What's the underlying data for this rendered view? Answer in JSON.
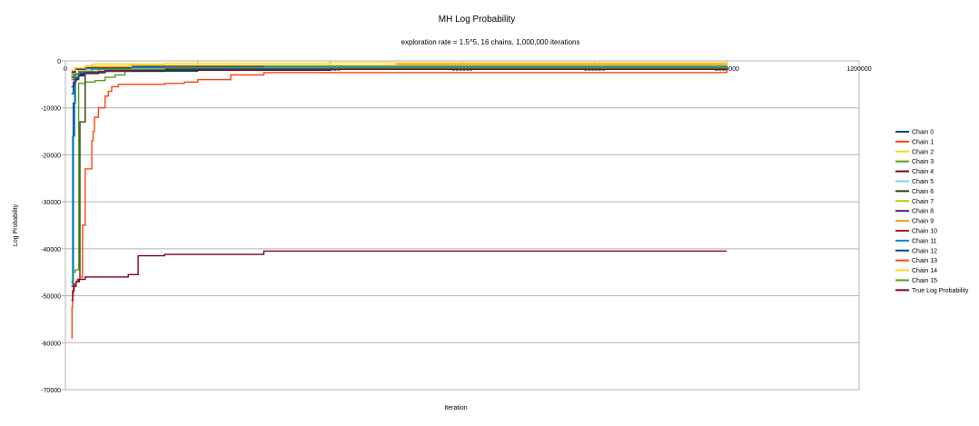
{
  "chart_data": {
    "type": "line",
    "title": "MH Log Probability",
    "subtitle": "exploration rate = 1.5^5, 16 chains, 1,000,000 iterations",
    "xlabel": "Iteration",
    "ylabel": "Log Probability",
    "xlim": [
      0,
      1200000
    ],
    "ylim": [
      -70000,
      0
    ],
    "x_ticks": [
      0,
      200000,
      400000,
      600000,
      800000,
      1000000,
      1200000
    ],
    "y_ticks": [
      0,
      -10000,
      -20000,
      -30000,
      -40000,
      -50000,
      -60000,
      -70000
    ],
    "grid": true,
    "legend_position": "right",
    "series": [
      {
        "name": "Chain 0",
        "color": "#004586",
        "step": true,
        "x": [
          9000,
          12000,
          15000,
          20000,
          60000,
          200000,
          400000,
          1000000
        ],
        "y": [
          -47000,
          -9000,
          -4000,
          -2500,
          -2200,
          -1800,
          -1300,
          -1000
        ]
      },
      {
        "name": "Chain 1",
        "color": "#ff420e",
        "step": true,
        "x": [
          9000,
          11000,
          15000,
          22000,
          50000,
          150000,
          300000,
          600000,
          1000000
        ],
        "y": [
          -3000,
          -2200,
          -1800,
          -1600,
          -1500,
          -1400,
          -1300,
          -1200,
          -1100
        ]
      },
      {
        "name": "Chain 2",
        "color": "#ffd320",
        "step": true,
        "x": [
          9000,
          15000,
          40000,
          150000,
          400000,
          1000000
        ],
        "y": [
          -3500,
          -1500,
          -700,
          -500,
          -400,
          -350
        ]
      },
      {
        "name": "Chain 3",
        "color": "#579d1c",
        "step": true,
        "x": [
          9000,
          12000,
          15000,
          20000,
          30000,
          45000,
          60000,
          75000,
          90000,
          110000,
          150000,
          200000,
          1000000
        ],
        "y": [
          -48000,
          -45000,
          -44500,
          -4800,
          -4500,
          -4200,
          -3500,
          -3000,
          -2200,
          -1800,
          -1500,
          -1300,
          -1200
        ]
      },
      {
        "name": "Chain 4",
        "color": "#7e0021",
        "step": true,
        "x": [
          9000,
          20000,
          30000,
          60000,
          150000,
          400000,
          1000000
        ],
        "y": [
          -3500,
          -2800,
          -2500,
          -2200,
          -2000,
          -1800,
          -1700
        ]
      },
      {
        "name": "Chain 5",
        "color": "#83caff",
        "step": true,
        "x": [
          9000,
          15000,
          60000,
          200000,
          1000000
        ],
        "y": [
          -2800,
          -1800,
          -1500,
          -1300,
          -1200
        ]
      },
      {
        "name": "Chain 6",
        "color": "#314004",
        "step": true,
        "x": [
          9000,
          12000,
          16000,
          21000,
          22000,
          30000,
          60000,
          200000,
          1000000
        ],
        "y": [
          -48000,
          -47500,
          -47000,
          -46500,
          -13000,
          -2500,
          -2000,
          -1600,
          -1400
        ]
      },
      {
        "name": "Chain 7",
        "color": "#aecf00",
        "step": true,
        "x": [
          9000,
          15000,
          30000,
          120000,
          1000000
        ],
        "y": [
          -2500,
          -1800,
          -1400,
          -1000,
          -800
        ]
      },
      {
        "name": "Chain 8",
        "color": "#4b1f6f",
        "step": true,
        "x": [
          9000,
          15000,
          30000,
          100000,
          300000,
          1000000
        ],
        "y": [
          -2400,
          -1800,
          -1500,
          -1200,
          -1000,
          -950
        ]
      },
      {
        "name": "Chain 9",
        "color": "#ff950e",
        "step": true,
        "x": [
          9000,
          15000,
          30000,
          100000,
          500000,
          1000000
        ],
        "y": [
          -2000,
          -1500,
          -1200,
          -900,
          -700,
          -600
        ]
      },
      {
        "name": "Chain 10",
        "color": "#c5000b",
        "step": true,
        "x": [
          9000,
          12000,
          16000,
          20000,
          30000,
          50000,
          100000,
          200000,
          1000000
        ],
        "y": [
          -5500,
          -4500,
          -3800,
          -3200,
          -2700,
          -2200,
          -1800,
          -1500,
          -1300
        ]
      },
      {
        "name": "Chain 11",
        "color": "#0084d1",
        "step": true,
        "x": [
          9000,
          11000,
          14000,
          20000,
          40000,
          100000,
          300000,
          1000000
        ],
        "y": [
          -48000,
          -16000,
          -2800,
          -2200,
          -1700,
          -1400,
          -1200,
          -1100
        ]
      },
      {
        "name": "Chain 12",
        "color": "#004586",
        "step": true,
        "x": [
          9000,
          12000,
          15000,
          20000,
          30000,
          60000,
          150000,
          400000,
          1000000
        ],
        "y": [
          -7000,
          -5000,
          -3800,
          -3000,
          -2500,
          -2000,
          -1700,
          -1500,
          -1400
        ]
      },
      {
        "name": "Chain 13",
        "color": "#ff420e",
        "step": true,
        "x": [
          9000,
          10000,
          11000,
          12000,
          14000,
          16000,
          18000,
          22000,
          26000,
          30000,
          40000,
          42000,
          44000,
          46000,
          50000,
          60000,
          65000,
          70000,
          80000,
          100000,
          150000,
          180000,
          200000,
          250000,
          300000,
          1000000
        ],
        "y": [
          -59000,
          -52500,
          -50000,
          -48000,
          -47500,
          -47000,
          -46500,
          -46000,
          -35000,
          -23000,
          -17000,
          -15000,
          -12000,
          -12000,
          -10000,
          -7500,
          -6500,
          -5500,
          -5000,
          -5000,
          -4800,
          -4500,
          -4000,
          -3000,
          -2500,
          -2000
        ]
      },
      {
        "name": "Chain 14",
        "color": "#ffd320",
        "step": true,
        "x": [
          9000,
          14000,
          30000,
          100000,
          1000000
        ],
        "y": [
          -2000,
          -1500,
          -1100,
          -900,
          -800
        ]
      },
      {
        "name": "Chain 15",
        "color": "#579d1c",
        "step": true,
        "x": [
          9000,
          12000,
          20000,
          50000,
          150000,
          1000000
        ],
        "y": [
          -4000,
          -3000,
          -2200,
          -1800,
          -1500,
          -1300
        ]
      },
      {
        "name": "True Log Probability",
        "color": "#7e0021",
        "step": true,
        "x": [
          9000,
          11000,
          13000,
          16000,
          20000,
          30000,
          60000,
          95000,
          110000,
          150000,
          300000,
          1000000
        ],
        "y": [
          -51000,
          -49000,
          -48000,
          -47000,
          -46500,
          -46000,
          -46000,
          -45500,
          -41500,
          -41200,
          -40500,
          -40500
        ]
      }
    ]
  }
}
